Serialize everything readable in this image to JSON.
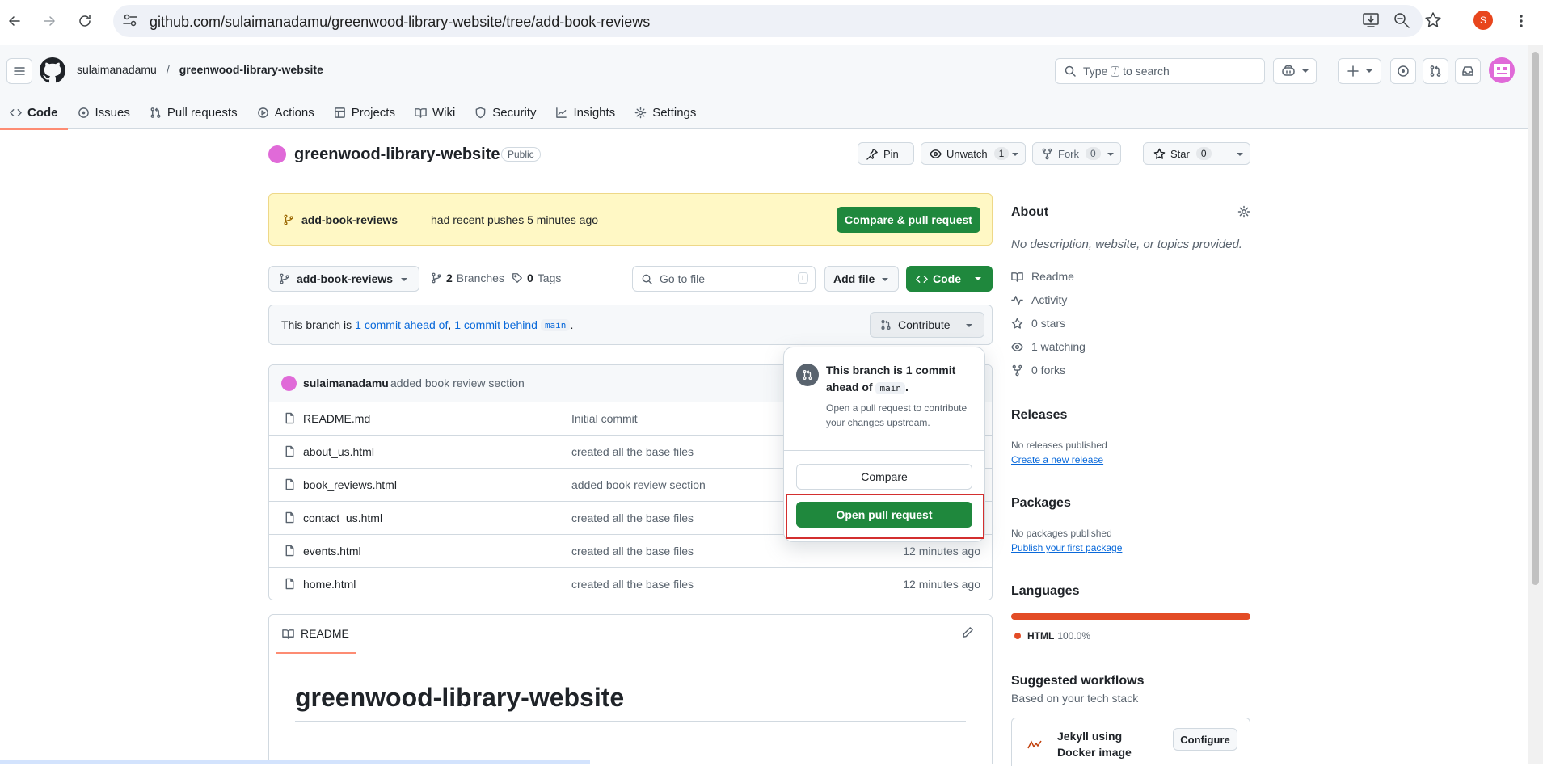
{
  "browser": {
    "url": "github.com/sulaimanadamu/greenwood-library-website/tree/add-book-reviews",
    "profile_initial": "S"
  },
  "header": {
    "owner": "sulaimanadamu",
    "separator": "/",
    "repo": "greenwood-library-website",
    "search_type": "Type",
    "search_key": "/",
    "search_rest": "to search"
  },
  "tabs": [
    {
      "label": "Code",
      "icon": "code-icon"
    },
    {
      "label": "Issues",
      "icon": "issue-icon"
    },
    {
      "label": "Pull requests",
      "icon": "pull-request-icon"
    },
    {
      "label": "Actions",
      "icon": "play-icon"
    },
    {
      "label": "Projects",
      "icon": "table-icon"
    },
    {
      "label": "Wiki",
      "icon": "book-icon"
    },
    {
      "label": "Security",
      "icon": "shield-icon"
    },
    {
      "label": "Insights",
      "icon": "graph-icon"
    },
    {
      "label": "Settings",
      "icon": "gear-icon"
    }
  ],
  "repo": {
    "name": "greenwood-library-website",
    "visibility": "Public",
    "pin": "Pin",
    "unwatch": "Unwatch",
    "watch_count": "1",
    "fork": "Fork",
    "fork_count": "0",
    "star": "Star",
    "star_count": "0"
  },
  "banner": {
    "branch": "add-book-reviews",
    "text": "had recent pushes 5 minutes ago",
    "button": "Compare & pull request"
  },
  "toolbar": {
    "branch": "add-book-reviews",
    "branches_count": "2",
    "branches_label": "Branches",
    "tags_count": "0",
    "tags_label": "Tags",
    "goto_placeholder": "Go to file",
    "goto_key": "t",
    "add_file": "Add file",
    "code": "Code"
  },
  "status": {
    "prefix": "This branch is",
    "ahead": "1 commit ahead of",
    "comma": ",",
    "behind": "1 commit behind",
    "base": "main",
    "suffix": ".",
    "contribute": "Contribute"
  },
  "commit": {
    "author": "sulaimanadamu",
    "message": "added book review section"
  },
  "files": [
    {
      "name": "README.md",
      "message": "Initial commit",
      "time": ""
    },
    {
      "name": "about_us.html",
      "message": "created all the base files",
      "time": ""
    },
    {
      "name": "book_reviews.html",
      "message": "added book review section",
      "time": ""
    },
    {
      "name": "contact_us.html",
      "message": "created all the base files",
      "time": ""
    },
    {
      "name": "events.html",
      "message": "created all the base files",
      "time": "12 minutes ago"
    },
    {
      "name": "home.html",
      "message": "created all the base files",
      "time": "12 minutes ago"
    }
  ],
  "popover": {
    "title_a": "This branch is 1 commit",
    "title_b": "ahead of",
    "base": "main",
    "title_end": ".",
    "desc": "Open a pull request to contribute your changes upstream.",
    "compare": "Compare",
    "open_pr": "Open pull request"
  },
  "readme": {
    "tab": "README",
    "heading": "greenwood-library-website"
  },
  "sidebar": {
    "about_title": "About",
    "about_desc": "No description, website, or topics provided.",
    "items": [
      {
        "icon": "book-icon",
        "label": "Readme"
      },
      {
        "icon": "pulse-icon",
        "label": "Activity"
      },
      {
        "icon": "star-icon",
        "label": "0 stars"
      },
      {
        "icon": "eye-icon",
        "label": "1 watching"
      },
      {
        "icon": "fork-icon",
        "label": "0 forks"
      }
    ],
    "releases_title": "Releases",
    "releases_none": "No releases published",
    "releases_link": "Create a new release",
    "packages_title": "Packages",
    "packages_none": "No packages published",
    "packages_link": "Publish your first package",
    "languages_title": "Languages",
    "language": "HTML",
    "language_pct": "100.0%",
    "language_share": 1.0,
    "workflows_title": "Suggested workflows",
    "workflows_sub": "Based on your tech stack",
    "workflow_name": "Jekyll using Docker image",
    "configure": "Configure"
  },
  "colors": {
    "green": "#1f883d",
    "accent": "#fd8c73",
    "html_lang": "#e34c26",
    "link": "#0969da"
  }
}
